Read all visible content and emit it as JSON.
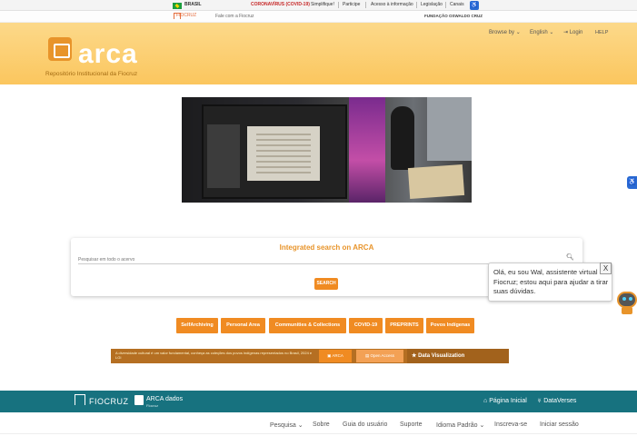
{
  "gov_bar": {
    "country": "BRASIL",
    "covid": "CORONAVÍRUS (COVID-19)",
    "links": [
      "Simplifique!",
      "Participe",
      "Acesso à informação",
      "Legislação",
      "Canais"
    ]
  },
  "fiocruz_bar": {
    "logo": "FIOCRUZ",
    "talk": "Fale com a Fiocruz",
    "foundation": "FUNDAÇÃO OSWALDO CRUZ"
  },
  "header": {
    "logo_text": "arca",
    "subtitle": "Repositório Institucional da Fiocruz",
    "browse": "Browse by",
    "language": "English",
    "login": "Login",
    "help": "HELP"
  },
  "search": {
    "title": "Integrated search on ARCA",
    "placeholder": "Pesquisar em todo o acervo",
    "button": "SEARCH"
  },
  "chatbot": {
    "message": "Olá, eu sou Wal, assistente virtual da Fiocruz; estou aqui para ajudar a tirar suas dúvidas.",
    "close": "X"
  },
  "quick_links": [
    "SelfArchiving",
    "Personal Area",
    "Communities & Collections",
    "COVID-19",
    "PREPRINTS",
    "Povos Indígenas"
  ],
  "banner": {
    "text": "A diversidade cultural é um valor fundamental, conheça as coleções dos povos indígenas representados no Brasil, 2024 e LGI",
    "btn_arca": "ARCA",
    "btn_open": "Open Access",
    "btn_dataviz": "Data Visualization"
  },
  "dataverse_bar": {
    "fiocruz": "FIOCRUZ",
    "arca_dados": "ARCA dados",
    "arca_sub": "Fiocruz",
    "home": "Página Inicial",
    "dataverses": "DataVerses"
  },
  "bottom_nav": [
    "Pesquisa",
    "Sobre",
    "Guia do usuário",
    "Suporte",
    "Idioma Padrão",
    "Inscreva-se",
    "Iniciar sessão"
  ],
  "colors": {
    "orange": "#f08b22",
    "header_gold": "#fbc65e",
    "teal": "#17727f"
  }
}
